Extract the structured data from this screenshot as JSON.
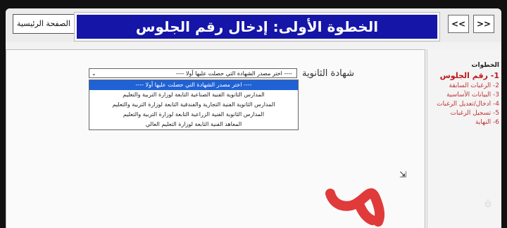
{
  "header": {
    "home_button": "الصفحة الرئيسية",
    "title": "الخطوة الأولى: إدخال رقم الجلوس",
    "nav_prev": "<<",
    "nav_next": ">>"
  },
  "form": {
    "label": "شهادة الثانوية",
    "select_value": "---- اختر مصدر الشهادة التي حصلت عليها أولا ----",
    "options": [
      "---- اختر مصدر الشهادة التي حصلت عليها أولا ----",
      "المدارس الثانوية الفنية الصناعية التابعة لوزارة التربية والتعليم",
      "المدارس الثانوية الفنية التجارية والفندقية التابعة لوزارة التربية والتعليم",
      "المدارس الثانوية الفنية الزراعية التابعة لوزارة التربية والتعليم",
      "المعاهد الفنية التابعة لوزارة التعليم العالي"
    ]
  },
  "sidebar": {
    "title": "الخطوات",
    "steps": [
      "1- رقم الجلوس",
      "2- الرغبات السابقة",
      "3- البيانات الأساسية",
      "4- ادخال/تعديل الرغبات",
      "5- تسجيل الرغبات",
      "6- النهاية"
    ]
  },
  "colors": {
    "title_bg": "#1515a8",
    "step_red": "#c03030",
    "highlight": "#1f62d6",
    "brush_red": "#e03a3a"
  }
}
